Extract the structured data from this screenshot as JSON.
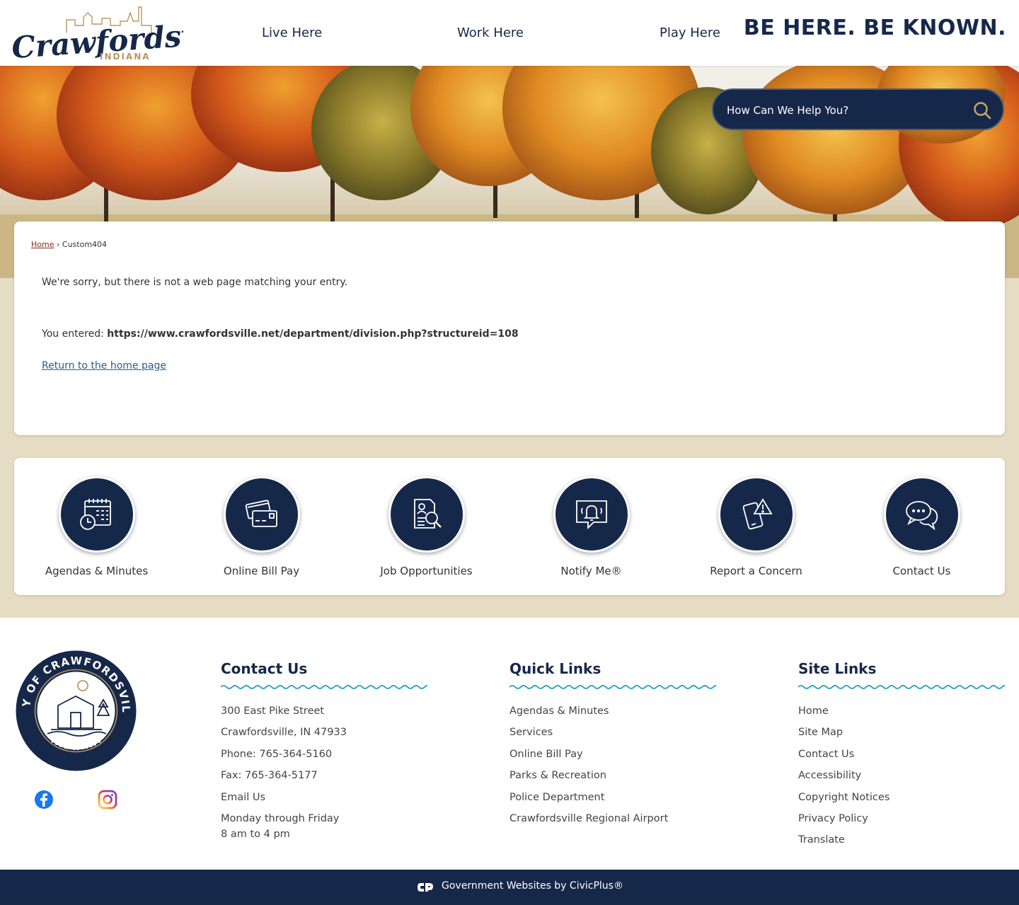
{
  "header": {
    "logo_text": "Crawfordsville",
    "logo_subtext": "INDIANA",
    "nav": [
      "Live Here",
      "Work Here",
      "Play Here"
    ],
    "tagline": "BE HERE. BE KNOWN."
  },
  "search": {
    "placeholder": "How Can We Help You?",
    "icon": "search-icon"
  },
  "breadcrumb": {
    "home": "Home",
    "separator": "›",
    "current": "Custom404"
  },
  "content": {
    "message": "We're sorry, but there is not a web page matching your entry.",
    "entered_label": "You entered:",
    "entered_url": "https://www.crawfordsville.net/department/division.php?structureid=108",
    "home_link": "Return to the home page"
  },
  "quick_links": [
    {
      "label": "Agendas & Minutes",
      "icon": "calendar-clock-icon"
    },
    {
      "label": "Online Bill Pay",
      "icon": "credit-card-icon"
    },
    {
      "label": "Job Opportunities",
      "icon": "document-search-icon"
    },
    {
      "label": "Notify Me®",
      "icon": "bell-chat-icon"
    },
    {
      "label": "Report a Concern",
      "icon": "phone-alert-icon"
    },
    {
      "label": "Contact Us",
      "icon": "chat-bubbles-icon"
    }
  ],
  "footer": {
    "seal_text_top": "CITY OF CRAWFORDSVILLE",
    "seal_text_bottom": "INDIANA",
    "social": [
      "facebook-icon",
      "instagram-icon"
    ],
    "contact": {
      "title": "Contact Us",
      "lines": [
        "300 East Pike Street",
        "Crawfordsville, IN 47933",
        "Phone: 765-364-5160",
        "Fax: 765-364-5177",
        "Email Us",
        "Monday through Friday",
        "8 am to 4 pm"
      ]
    },
    "quick": {
      "title": "Quick Links",
      "items": [
        "Agendas & Minutes",
        "Services",
        "Online Bill Pay",
        "Parks & Recreation",
        "Police Department",
        "Crawfordsville Regional Airport"
      ]
    },
    "site": {
      "title": "Site Links",
      "items": [
        "Home",
        "Site Map",
        "Contact Us",
        "Accessibility",
        "Copyright Notices",
        "Privacy Policy",
        "Translate"
      ]
    }
  },
  "bottom_bar": {
    "text": "Government Websites by CivicPlus®"
  },
  "colors": {
    "navy": "#16284a",
    "beige": "#e6dcc3",
    "teal_wave": "#2aa3b8",
    "link_red": "#8a2a1e"
  }
}
